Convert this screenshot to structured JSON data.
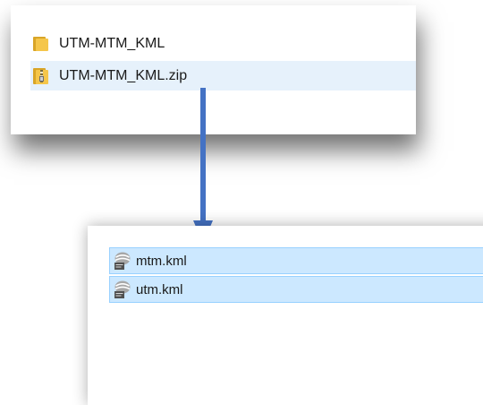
{
  "top_explorer": {
    "items": [
      {
        "name": "UTM-MTM_KML",
        "icon": "folder-icon",
        "selected": false
      },
      {
        "name": "UTM-MTM_KML.zip",
        "icon": "zip-folder-icon",
        "hover": true
      }
    ]
  },
  "bottom_explorer": {
    "items": [
      {
        "name": "mtm.kml",
        "icon": "kml-file-icon",
        "selected": true
      },
      {
        "name": "utm.kml",
        "icon": "kml-file-icon",
        "selected": true
      }
    ]
  },
  "colors": {
    "arrow": "#4472c4",
    "selection": "#cce8ff",
    "selection_border": "#99d1ff",
    "hover": "#e6f1fb",
    "folder": "#f5c64a"
  }
}
